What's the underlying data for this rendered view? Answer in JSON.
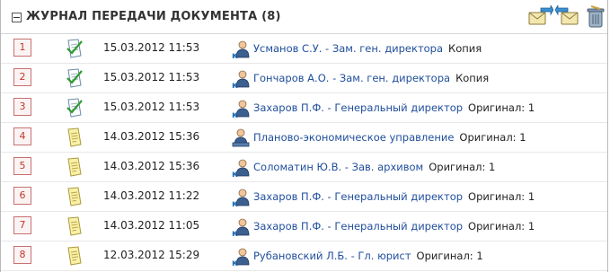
{
  "header": {
    "title": "ЖУРНАЛ ПЕРЕДАЧИ ДОКУМЕНТА (8)",
    "tools": [
      {
        "name": "send-icon"
      },
      {
        "name": "return-icon"
      },
      {
        "name": "trash-icon"
      }
    ]
  },
  "rows": [
    {
      "num": "1",
      "status": "checked",
      "datetime": "15.03.2012 11:53",
      "person": "person",
      "recipient": "Усманов С.У. - Зам. ген. директора",
      "type": "Копия"
    },
    {
      "num": "2",
      "status": "checked",
      "datetime": "15.03.2012 11:53",
      "person": "person",
      "recipient": "Гончаров А.О. - Зам. ген. директора",
      "type": "Копия"
    },
    {
      "num": "3",
      "status": "checked",
      "datetime": "15.03.2012 11:53",
      "person": "person",
      "recipient": "Захаров П.Ф. - Генеральный директор",
      "type": "Оригинал: 1"
    },
    {
      "num": "4",
      "status": "pending",
      "datetime": "14.03.2012 15:36",
      "person": "department",
      "recipient": "Планово-экономическое управление",
      "type": "Оригинал: 1"
    },
    {
      "num": "5",
      "status": "pending",
      "datetime": "14.03.2012 15:36",
      "person": "person",
      "recipient": "Соломатин Ю.В. - Зав. архивом",
      "type": "Оригинал: 1"
    },
    {
      "num": "6",
      "status": "pending",
      "datetime": "14.03.2012 11:22",
      "person": "person",
      "recipient": "Захаров П.Ф. - Генеральный директор",
      "type": "Оригинал: 1"
    },
    {
      "num": "7",
      "status": "pending",
      "datetime": "14.03.2012 11:05",
      "person": "person",
      "recipient": "Захаров П.Ф. - Генеральный директор",
      "type": "Оригинал: 1"
    },
    {
      "num": "8",
      "status": "pending",
      "datetime": "12.03.2012 15:29",
      "person": "person",
      "recipient": "Рубановский Л.Б. - Гл. юрист",
      "type": "Оригинал: 1"
    }
  ],
  "colors": {
    "link": "#1f4e9c",
    "number_border": "#c87070",
    "number_text": "#c0392b"
  }
}
